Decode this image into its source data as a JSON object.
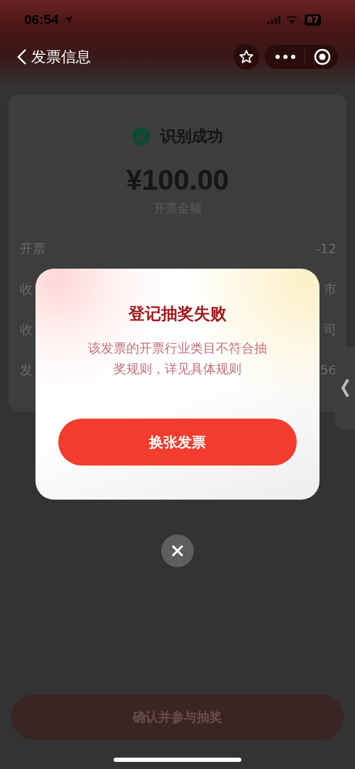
{
  "status_bar": {
    "time": "06:54",
    "battery": "87"
  },
  "nav": {
    "title": "发票信息"
  },
  "result": {
    "status": "识别成功",
    "amount": "¥100.00",
    "amount_label": "开票金额"
  },
  "rows": [
    {
      "label": "开票",
      "value": "-12"
    },
    {
      "label": "收",
      "value": "市"
    },
    {
      "label": "收",
      "value": "司"
    },
    {
      "label": "发",
      "value": "56"
    }
  ],
  "dialog": {
    "title": "登记抽奖失败",
    "message": "该发票的开票行业类目不符合抽奖规则，详见具体规则",
    "button": "换张发票"
  },
  "confirm_button": {
    "label": "确认并参与抽奖",
    "disabled": true
  }
}
